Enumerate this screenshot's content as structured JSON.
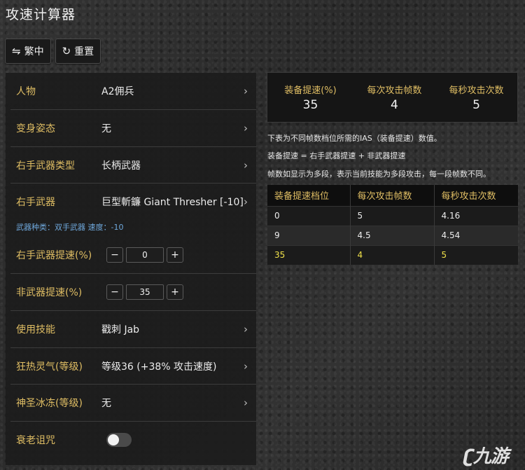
{
  "app": {
    "title": "攻速计算器"
  },
  "toolbar": {
    "lang_icon": "⇋",
    "lang_label": "繁中",
    "reset_icon": "↻",
    "reset_label": "重置"
  },
  "form": {
    "character": {
      "label": "人物",
      "value": "A2佣兵"
    },
    "shapeshift": {
      "label": "变身姿态",
      "value": "无"
    },
    "weapon_type": {
      "label": "右手武器类型",
      "value": "长柄武器"
    },
    "weapon": {
      "label": "右手武器",
      "value": "巨型斬鐮 Giant Thresher [-10]"
    },
    "weapon_info": "武器种类：双手武器 速度：-10",
    "weapon_ias": {
      "label": "右手武器提速(%)",
      "value": "0"
    },
    "offweapon_ias": {
      "label": "非武器提速(%)",
      "value": "35"
    },
    "skill": {
      "label": "使用技能",
      "value": "戳刺 Jab"
    },
    "fanaticism": {
      "label": "狂热灵气(等级)",
      "value": "等级36 (+38% 攻击速度)"
    },
    "holy_freeze": {
      "label": "神圣冰冻(等级)",
      "value": "无"
    },
    "decrepify": {
      "label": "衰老诅咒",
      "enabled": false
    }
  },
  "summary": {
    "ias": {
      "label": "装备提速(%)",
      "value": "35"
    },
    "frames": {
      "label": "每次攻击帧数",
      "value": "4"
    },
    "aps": {
      "label": "每秒攻击次数",
      "value": "5"
    }
  },
  "notes": [
    "下表为不同帧数档位所需的IAS（装备提速）数值。",
    "装备提速 = 右手武器提速 + 非武器提速",
    "帧数如显示为多段，表示当前技能为多段攻击，每一段帧数不同。"
  ],
  "table": {
    "headers": [
      "装备提速档位",
      "每次攻击帧数",
      "每秒攻击次数"
    ],
    "rows": [
      [
        "0",
        "5",
        "4.16"
      ],
      [
        "9",
        "4.5",
        "4.54"
      ],
      [
        "35",
        "4",
        "5"
      ]
    ]
  },
  "watermark": "九游",
  "colors": {
    "accent_gold": "#e0be64",
    "highlight_yellow": "#f0e14a",
    "info_blue": "#6fa8dc"
  }
}
